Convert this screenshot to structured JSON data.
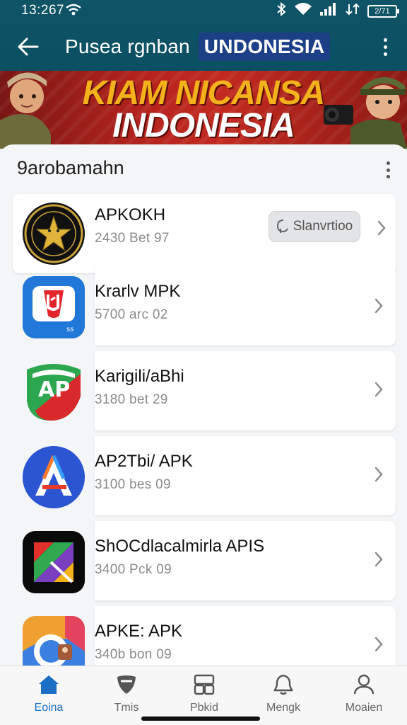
{
  "status_bar": {
    "time": "13:267",
    "battery": "2/71"
  },
  "app_bar": {
    "title": "Pusea rgnban",
    "title_badge": "UNDONESIA"
  },
  "banner": {
    "line1": "KIAM NICANSA",
    "line2": "INDONESIA"
  },
  "section": {
    "title": "9arobamahn"
  },
  "apps": [
    {
      "name": "APKOKH",
      "meta": "2430 Bet   97",
      "action": "Slanvrtioo",
      "icon": "star-emblem-icon"
    },
    {
      "name": "Krarlv MPK",
      "meta": "5700 arc   02",
      "icon": "red-shield-logo-icon"
    },
    {
      "name": "Karigili/aBhi",
      "meta": "3180 bet   29",
      "icon": "green-flag-logo-icon"
    },
    {
      "name": "AP2Tbi/ APK",
      "meta": "3100 bes   09",
      "icon": "blue-a-logo-icon"
    },
    {
      "name": "ShOCdlacalmirla APIS",
      "meta": "3400 Pck   09",
      "icon": "multicolor-k-logo-icon"
    },
    {
      "name": "APKE: APK",
      "meta": "340b bon   09",
      "icon": "gradient-circle-logo-icon"
    }
  ],
  "bottom_nav": [
    {
      "label": "Eoina",
      "icon": "home-icon",
      "active": true
    },
    {
      "label": "Tmis",
      "icon": "shield-icon",
      "active": false
    },
    {
      "label": "Pbkid",
      "icon": "grid-icon",
      "active": false
    },
    {
      "label": "Mengk",
      "icon": "bell-icon",
      "active": false
    },
    {
      "label": "Moaien",
      "icon": "profile-icon",
      "active": false
    }
  ],
  "colors": {
    "header": "#0e5466",
    "badge": "#1d3f86",
    "banner_red": "#b5231d",
    "banner_yellow": "#f3b21b",
    "accent": "#1a6fc4"
  }
}
